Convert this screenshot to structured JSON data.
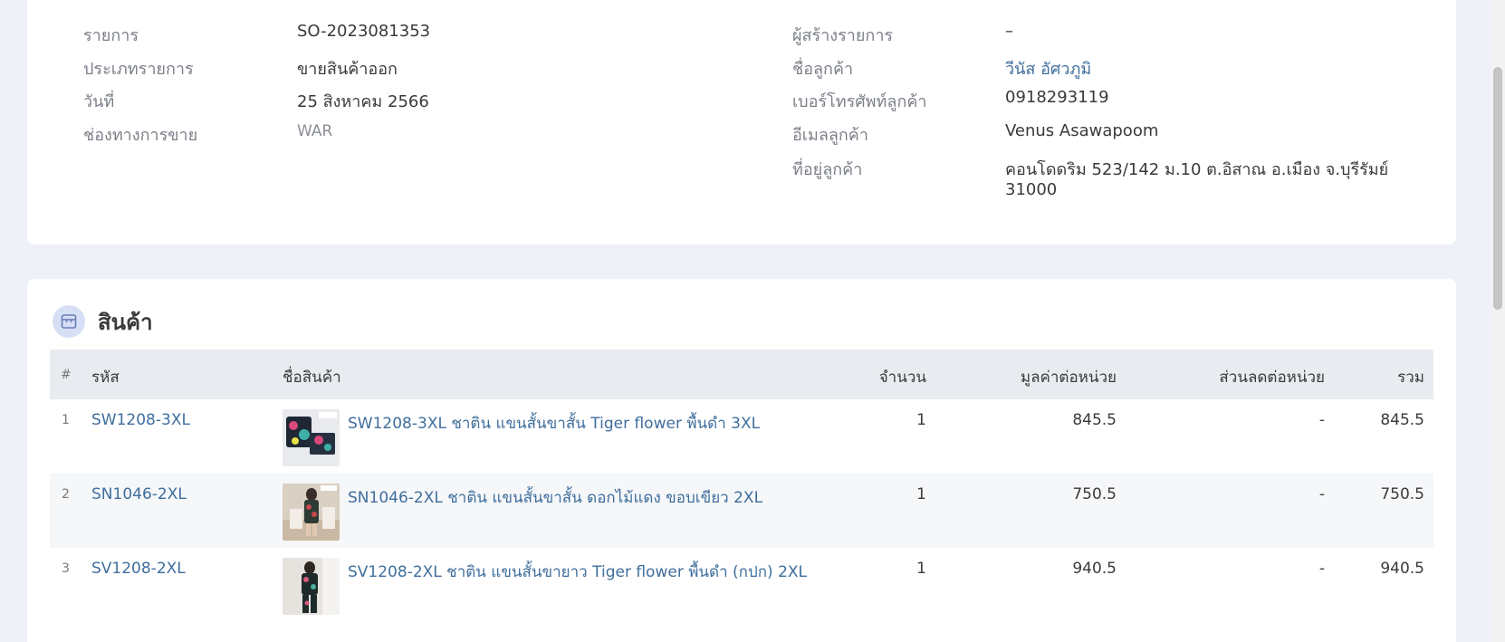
{
  "info": {
    "left": [
      {
        "label": "รายการ",
        "value": "SO-2023081353"
      },
      {
        "label": "ประเภทรายการ",
        "value": "ขายสินค้าออก"
      },
      {
        "label": "วันที่",
        "value": "25 สิงหาคม 2566"
      },
      {
        "label": "ช่องทางการขาย",
        "value": "WAR"
      }
    ],
    "right": [
      {
        "label": "ผู้สร้างรายการ",
        "value": "–"
      },
      {
        "label": "ชื่อลูกค้า",
        "value": "วีนัส อัศวภูมิ"
      },
      {
        "label": "เบอร์โทรศัพท์ลูกค้า",
        "value": "0918293119"
      },
      {
        "label": "อีเมลลูกค้า",
        "value": "Venus Asawapoom"
      },
      {
        "label": "ที่อยู่ลูกค้า",
        "value_line1": "คอนโดดริม 523/142 ม.10 ต.อิสาณ อ.เมือง จ.บุรีรัมย์",
        "value_line2": "31000"
      }
    ]
  },
  "products": {
    "title": "สินค้า",
    "icon": "box-icon",
    "columns": {
      "index": "#",
      "code": "รหัส",
      "name": "ชื่อสินค้า",
      "qty": "จำนวน",
      "unit_price": "มูลค่าต่อหน่วย",
      "unit_discount": "ส่วนลดต่อหน่วย",
      "total": "รวม"
    },
    "rows": [
      {
        "index": "1",
        "code": "SW1208-3XL",
        "name": "SW1208-3XL ชาติน แขนสั้นขาสั้น Tiger flower พื้นดำ 3XL",
        "qty": "1",
        "unit_price": "845.5",
        "unit_discount": "-",
        "total": "845.5"
      },
      {
        "index": "2",
        "code": "SN1046-2XL",
        "name": "SN1046-2XL ชาติน แขนสั้นขาสั้น ดอกไม้แดง ขอบเขียว 2XL",
        "qty": "1",
        "unit_price": "750.5",
        "unit_discount": "-",
        "total": "750.5"
      },
      {
        "index": "3",
        "code": "SV1208-2XL",
        "name": "SV1208-2XL ชาติน แขนสั้นขายาว Tiger flower พื้นดำ (กปก) 2XL",
        "qty": "1",
        "unit_price": "940.5",
        "unit_discount": "-",
        "total": "940.5"
      }
    ]
  },
  "colors": {
    "background": "#eef1f8",
    "card": "#ffffff",
    "link": "#3f6e9d",
    "table_header": "#e8ebef",
    "row_alt": "#f5f7f9",
    "icon_circle": "#d6dff5"
  }
}
